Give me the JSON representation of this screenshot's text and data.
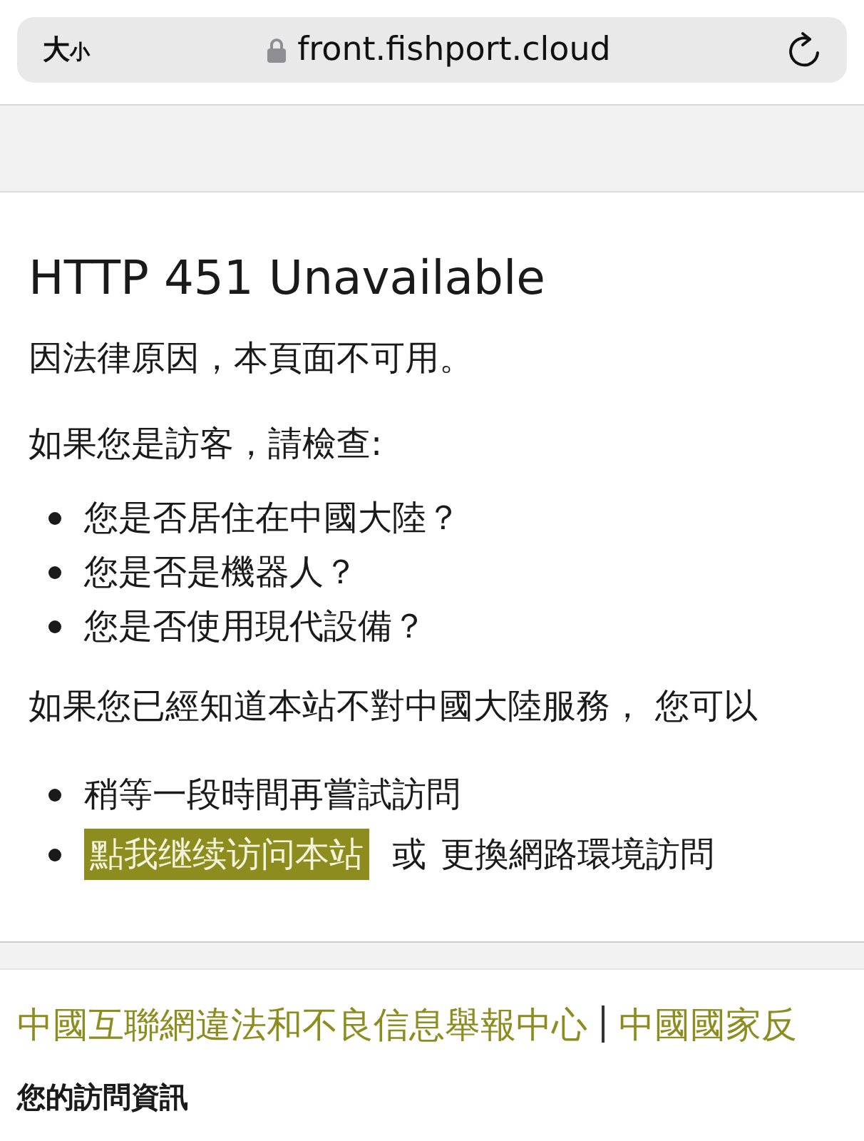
{
  "address_bar": {
    "text_size_button": "大小",
    "url": "front.fishport.cloud"
  },
  "page": {
    "title": "HTTP 451 Unavailable",
    "intro": "因法律原因，本頁面不可用。",
    "visitor_prompt": "如果您是訪客，請檢查:",
    "checks": [
      "您是否居住在中國大陸？",
      "您是否是機器人？",
      "您是否使用現代設備？"
    ],
    "known_prompt": "如果您已經知道本站不對中國大陸服務， 您可以",
    "options": [
      {
        "kind": "text",
        "text": "稍等一段時間再嘗試訪問"
      },
      {
        "kind": "link_choice",
        "link": "點我继续访问本站",
        "joiner": "或",
        "text": "更換網路環境訪問"
      }
    ]
  },
  "footer": {
    "links": [
      "中國互聯網違法和不良信息舉報中心",
      "中國國家反"
    ],
    "visit_info_heading": "您的訪問資訊"
  }
}
